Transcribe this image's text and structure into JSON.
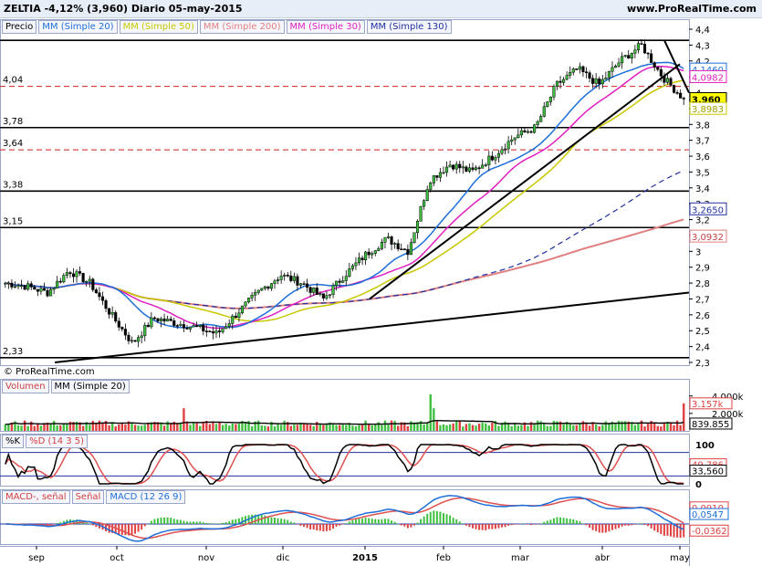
{
  "header": {
    "title": "ZELTIA   -4,12% (3,960)   Diario   05-may-2015",
    "site": "www.ProRealTime.com"
  },
  "price_panel": {
    "legend": [
      "Precio",
      "MM (Simple 20)",
      "MM (Simple 50)",
      "MM (Simple 200)",
      "MM (Simple 30)",
      "MM (Simple 130)"
    ],
    "legend_colors": [
      "#000000",
      "#1e6fd9",
      "#c8c800",
      "#e08080",
      "#e020c0",
      "#2030a0"
    ],
    "copyright": "© ProRealTime.com",
    "left_levels": [
      "4,04",
      "3,78",
      "3,64",
      "3,38",
      "3,15",
      "2,33"
    ],
    "y_ticks": [
      "4,4",
      "4,3",
      "4,2",
      "4,1",
      "4",
      "3,9",
      "3,8",
      "3,7",
      "3,6",
      "3,5",
      "3,4",
      "3,3",
      "3,2",
      "3,1",
      "3",
      "2,9",
      "2,8",
      "2,7",
      "2,6",
      "2,5",
      "2,4",
      "2,3"
    ],
    "value_tags": [
      "4,1460",
      "4,0982",
      "3,960",
      "3,8983",
      "3,2650",
      "3,0932"
    ]
  },
  "volume_panel": {
    "legend": [
      "Volumen",
      "MM (Simple 20)"
    ],
    "y_ticks": [
      "4.000k",
      "2.000k"
    ],
    "value_tags": [
      "3.157k",
      "839.855"
    ]
  },
  "stoch_panel": {
    "legend": [
      "%K",
      "%D (14 3 5)"
    ],
    "y_ticks": [
      "100",
      "0"
    ],
    "value_tags": [
      "49,786",
      "33,560"
    ]
  },
  "macd_panel": {
    "legend": [
      "MACD-, señal",
      "Señal",
      "MACD (12 26 9)"
    ],
    "value_tags": [
      "0,0910",
      "0,0547",
      "-0,0362"
    ]
  },
  "x_axis": {
    "labels": [
      "sep",
      "oct",
      "nov",
      "dic",
      "2015",
      "feb",
      "mar",
      "abr",
      "may"
    ]
  },
  "chart_data": {
    "type": "candlestick",
    "symbol": "ZELTIA",
    "change": "-4,12%",
    "last": 3.96,
    "period": "Diario",
    "date": "05-may-2015",
    "x_labels": [
      "sep",
      "oct",
      "nov",
      "dic",
      "2015",
      "feb",
      "mar",
      "abr",
      "may"
    ],
    "ylim": [
      2.3,
      4.4
    ],
    "horizontal_levels": [
      4.04,
      3.78,
      3.64,
      3.38,
      3.15,
      2.33
    ],
    "close_path": [
      {
        "x": "sep",
        "y": 2.8
      },
      {
        "x": "sep",
        "y": 2.78
      },
      {
        "x": "sep",
        "y": 2.74
      },
      {
        "x": "oct",
        "y": 2.88
      },
      {
        "x": "oct",
        "y": 2.8
      },
      {
        "x": "oct",
        "y": 2.6
      },
      {
        "x": "oct",
        "y": 2.42
      },
      {
        "x": "oct",
        "y": 2.58
      },
      {
        "x": "nov",
        "y": 2.55
      },
      {
        "x": "nov",
        "y": 2.52
      },
      {
        "x": "nov",
        "y": 2.48
      },
      {
        "x": "nov",
        "y": 2.62
      },
      {
        "x": "dic",
        "y": 2.75
      },
      {
        "x": "dic",
        "y": 2.85
      },
      {
        "x": "dic",
        "y": 2.8
      },
      {
        "x": "dic",
        "y": 2.7
      },
      {
        "x": "2015",
        "y": 2.85
      },
      {
        "x": "2015",
        "y": 2.98
      },
      {
        "x": "2015",
        "y": 3.08
      },
      {
        "x": "2015",
        "y": 3.0
      },
      {
        "x": "feb",
        "y": 3.45
      },
      {
        "x": "feb",
        "y": 3.55
      },
      {
        "x": "feb",
        "y": 3.5
      },
      {
        "x": "mar",
        "y": 3.6
      },
      {
        "x": "mar",
        "y": 3.72
      },
      {
        "x": "mar",
        "y": 3.78
      },
      {
        "x": "mar",
        "y": 4.05
      },
      {
        "x": "abr",
        "y": 4.15
      },
      {
        "x": "abr",
        "y": 4.05
      },
      {
        "x": "abr",
        "y": 4.2
      },
      {
        "x": "abr",
        "y": 4.3
      },
      {
        "x": "may",
        "y": 4.1
      },
      {
        "x": "may",
        "y": 3.96
      }
    ],
    "series_last_values": [
      {
        "name": "MM (Simple 20)",
        "value": 4.146
      },
      {
        "name": "MM (Simple 30)",
        "value": 4.0982
      },
      {
        "name": "MM (Simple 50)",
        "value": 3.8983
      },
      {
        "name": "MM (Simple 130)",
        "value": 3.265
      },
      {
        "name": "MM (Simple 200)",
        "value": 3.0932
      }
    ]
  }
}
